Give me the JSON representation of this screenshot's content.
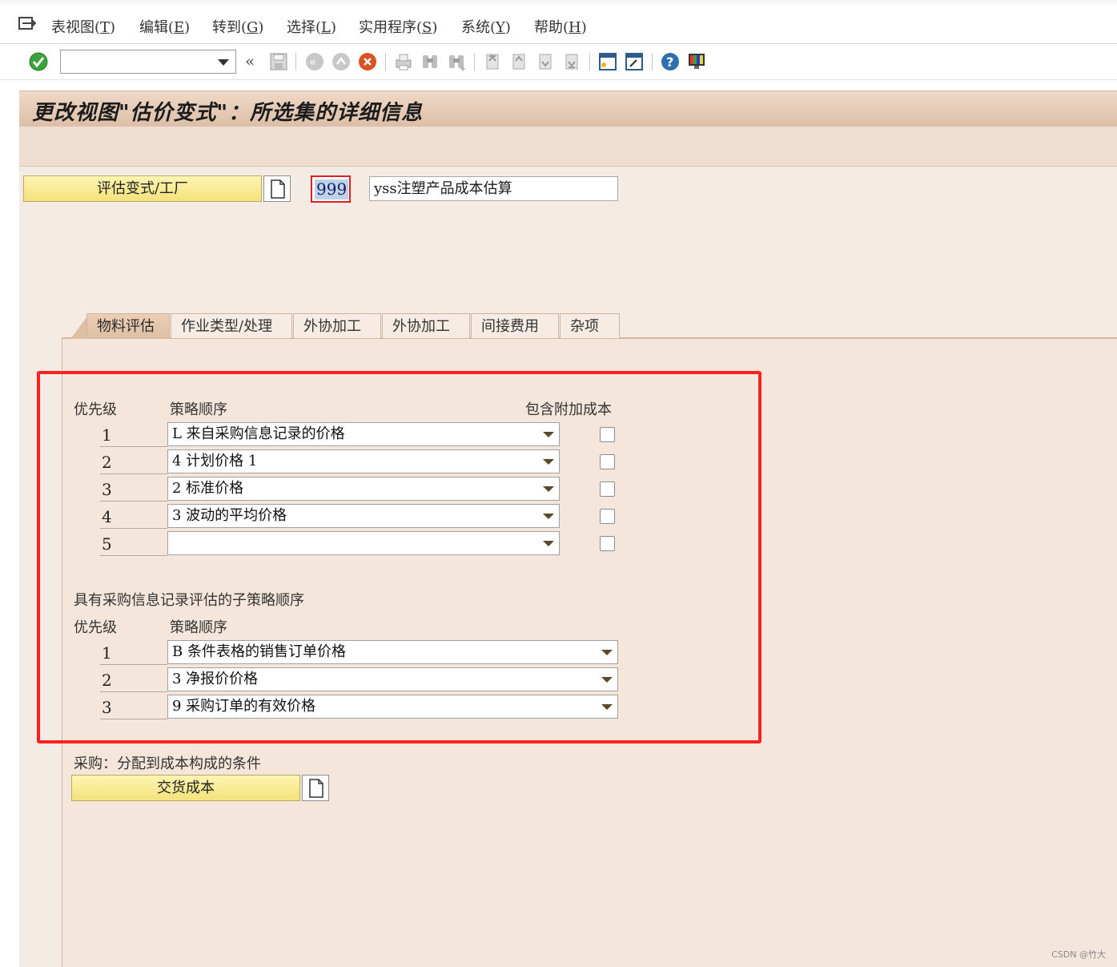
{
  "menu": {
    "items": [
      {
        "label": "表视图(",
        "key": "T",
        "suffix": ")"
      },
      {
        "label": "编辑(",
        "key": "E",
        "suffix": ")"
      },
      {
        "label": "转到(",
        "key": "G",
        "suffix": ")"
      },
      {
        "label": "选择(",
        "key": "L",
        "suffix": ")"
      },
      {
        "label": "实用程序(",
        "key": "S",
        "suffix": ")"
      },
      {
        "label": "系统(",
        "key": "Y",
        "suffix": ")"
      },
      {
        "label": "帮助(",
        "key": "H",
        "suffix": ")"
      }
    ]
  },
  "toolbar": {
    "command_value": "",
    "expand_glyph": "«"
  },
  "title": "更改视图\"估价变式\"：所选集的详细信息",
  "header": {
    "variant_button_label": "评估变式/工厂",
    "key_value": "999",
    "description": "yss注塑产品成本估算"
  },
  "tabs": [
    {
      "label": "物料评估",
      "active": true
    },
    {
      "label": "作业类型/处理",
      "active": false
    },
    {
      "label": "外协加工",
      "active": false
    },
    {
      "label": "外协加工",
      "active": false
    },
    {
      "label": "间接费用",
      "active": false
    },
    {
      "label": "杂项",
      "active": false
    }
  ],
  "strategy": {
    "col_priority": "优先级",
    "col_sequence": "策略顺序",
    "col_include": "包含附加成本",
    "rows": [
      {
        "priority": "1",
        "value": "L 来自采购信息记录的价格",
        "checked": false
      },
      {
        "priority": "2",
        "value": "4 计划价格 1",
        "checked": false
      },
      {
        "priority": "3",
        "value": "2 标准价格",
        "checked": false
      },
      {
        "priority": "4",
        "value": "3 波动的平均价格",
        "checked": false
      },
      {
        "priority": "5",
        "value": "",
        "checked": false
      }
    ]
  },
  "sub_strategy": {
    "section_title": "具有采购信息记录评估的子策略顺序",
    "col_priority": "优先级",
    "col_sequence": "策略顺序",
    "rows": [
      {
        "priority": "1",
        "value": "B 条件表格的销售订单价格"
      },
      {
        "priority": "2",
        "value": "3 净报价价格"
      },
      {
        "priority": "3",
        "value": "9 采购订单的有效价格"
      }
    ]
  },
  "purchasing": {
    "label": "采购：分配到成本构成的条件",
    "button_label": "交货成本"
  },
  "watermark": "CSDN @竹大"
}
